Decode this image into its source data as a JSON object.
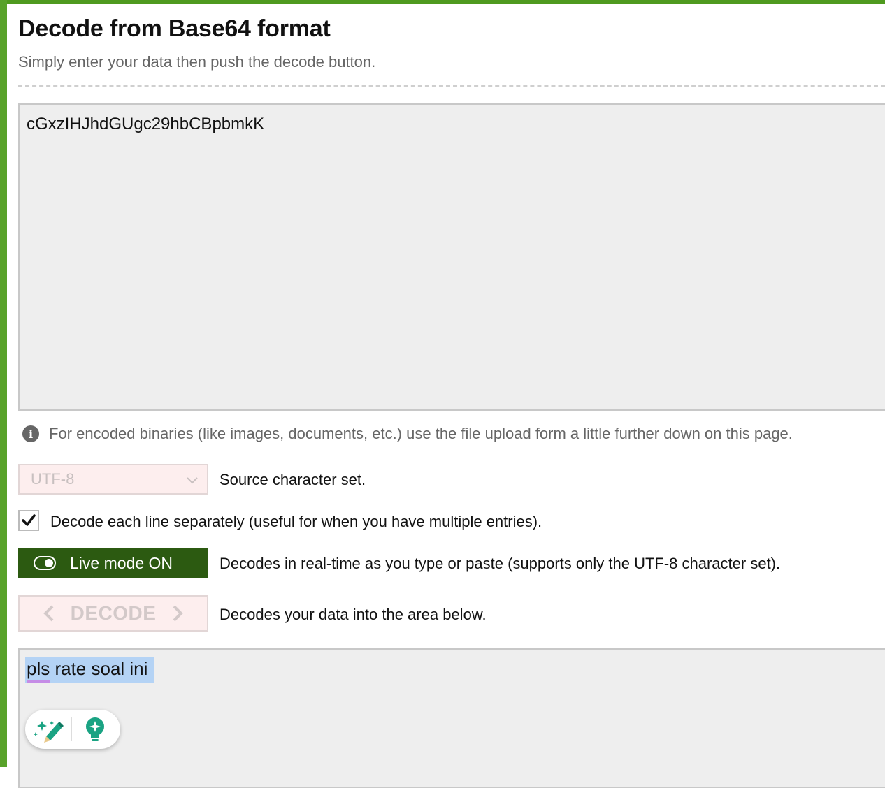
{
  "page": {
    "title": "Decode from Base64 format",
    "subtitle": "Simply enter your data then push the decode button."
  },
  "input": {
    "value": "cGxzIHJhdGUgc29hbCBpbmkK"
  },
  "info": {
    "text": "For encoded binaries (like images, documents, etc.) use the file upload form a little further down on this page."
  },
  "charset": {
    "selected": "UTF-8",
    "label": "Source character set."
  },
  "line_option": {
    "checked": true,
    "label": "Decode each line separately (useful for when you have multiple entries)."
  },
  "live_mode": {
    "button_label": "Live mode ON",
    "description": "Decodes in real-time as you type or paste (supports only the UTF-8 character set)."
  },
  "decode": {
    "button_label": "DECODE",
    "description": "Decodes your data into the area below."
  },
  "output": {
    "value": "pls rate soal ini"
  },
  "colors": {
    "accent_green": "#58a22a",
    "live_button": "#2c5a11",
    "disabled_pink": "#fdeeee",
    "selection_blue": "#b4d3f5"
  },
  "icons": [
    "info-icon",
    "chevron-down-icon",
    "checkmark-icon",
    "toggle-icon",
    "chevron-left-icon",
    "chevron-right-icon",
    "magic-pencil-icon",
    "lightbulb-icon"
  ]
}
